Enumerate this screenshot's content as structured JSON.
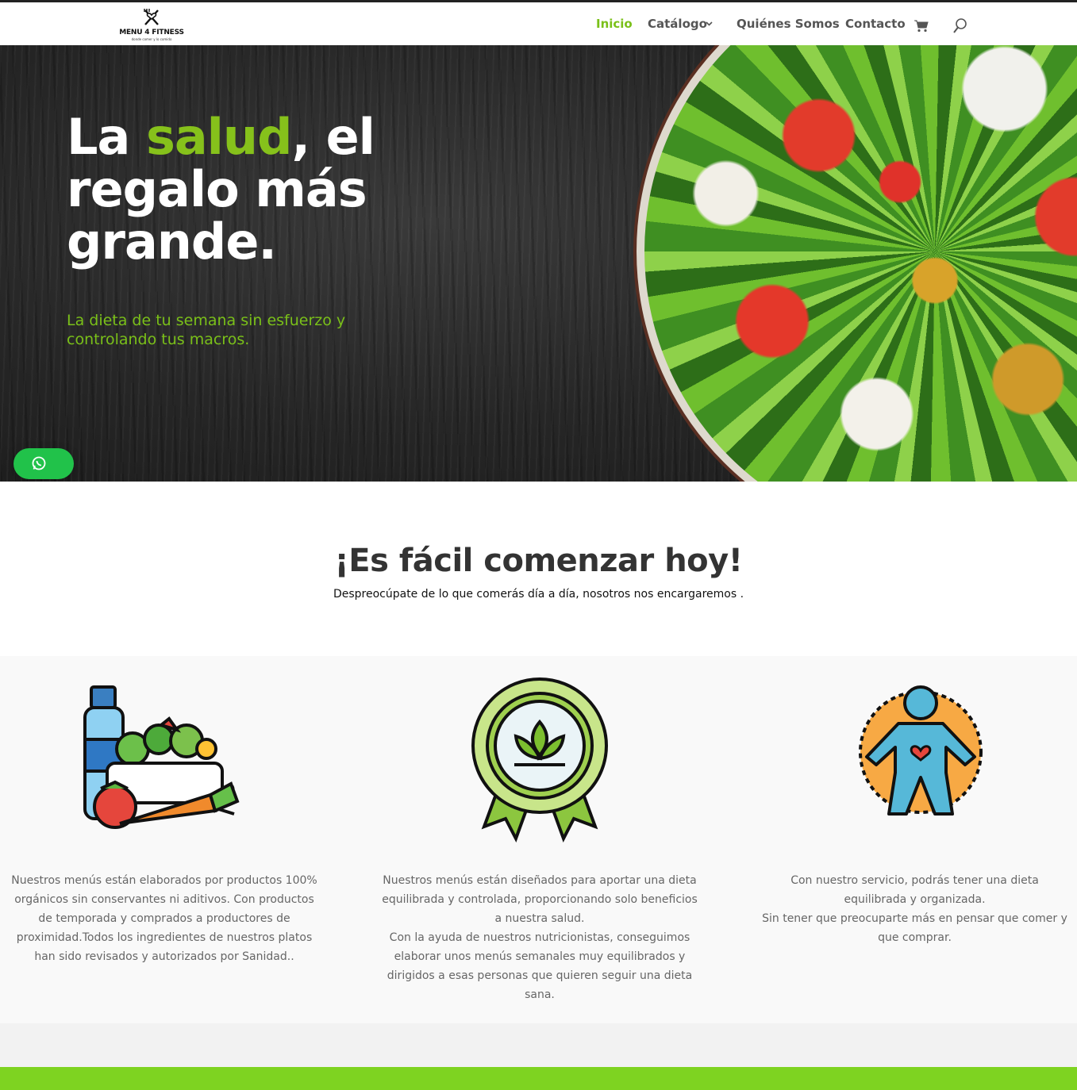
{
  "brand": {
    "name": "MENU 4 FITNESS",
    "tagline": "donde comer y lo comido"
  },
  "nav": {
    "items": [
      "Inicio",
      "Catálogo",
      "Quiénes Somos",
      "Contacto"
    ],
    "active": "Inicio"
  },
  "hero": {
    "title_pre": "La ",
    "title_highlight": "salud",
    "title_post": ", el",
    "title_line2": "regalo más",
    "title_line3": "grande.",
    "subtitle": "La dieta de tu semana sin esfuerzo y controlando tus macros."
  },
  "intro": {
    "title": "¡Es fácil comenzar hoy!",
    "subtitle": "Despreocúpate de lo que comerás día a día, nosotros nos encargaremos ."
  },
  "features": [
    {
      "icon": "healthy-food-icon",
      "text": "Nuestros menús están elaborados por productos 100% orgánicos sin conservantes ni aditivos. Con productos de temporada y comprados a productores de proximidad.Todos los ingredientes de nuestros platos han sido revisados y autorizados por Sanidad.."
    },
    {
      "icon": "quality-badge-icon",
      "text": "Nuestros menús están diseñados para aportar una dieta equilibrada y controlada, proporcionando solo beneficios a nuestra salud.\nCon la ayuda de nuestros nutricionistas, conseguimos elaborar unos menús semanales muy equilibrados y dirigidos a esas personas que quieren seguir una dieta sana."
    },
    {
      "icon": "healthy-body-icon",
      "text": "Con nuestro servicio, podrás tener una dieta equilibrada y organizada.\nSin tener que preocuparte más en pensar que comer y que comprar."
    }
  ],
  "colors": {
    "accent_green": "#7ac019",
    "whatsapp_green": "#21c24a",
    "footer_green": "#7ed321"
  }
}
